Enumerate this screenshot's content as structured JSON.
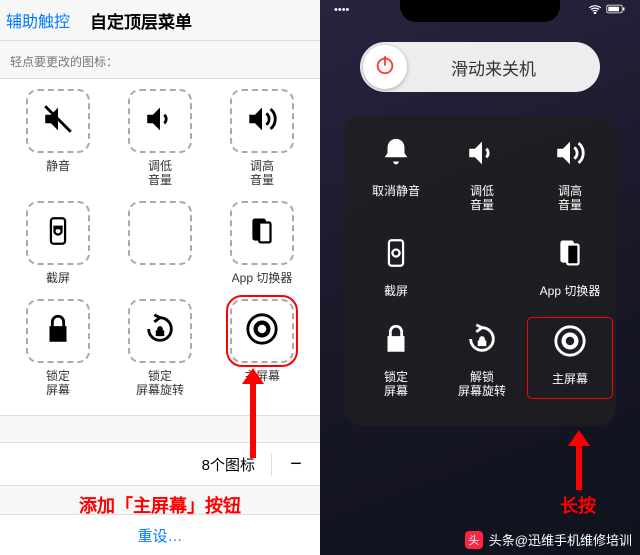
{
  "left": {
    "back": "辅助触控",
    "title": "自定顶层菜单",
    "hint": "轻点要更改的图标：",
    "items": [
      {
        "label": "静音"
      },
      {
        "label": "调低\n音量"
      },
      {
        "label": "调高\n音量"
      },
      {
        "label": "截屏"
      },
      {
        "label": ""
      },
      {
        "label": "App 切换器"
      },
      {
        "label": "锁定\n屏幕"
      },
      {
        "label": "锁定\n屏幕旋转"
      },
      {
        "label": "主屏幕"
      }
    ],
    "count_label": "8个图标",
    "caption": "添加「主屏幕」按钮",
    "reset": "重设…"
  },
  "right": {
    "power_label": "滑动来关机",
    "items": [
      {
        "label": "取消静音"
      },
      {
        "label": "调低\n音量"
      },
      {
        "label": "调高\n音量"
      },
      {
        "label": "截屏"
      },
      {
        "label": ""
      },
      {
        "label": "App 切换器"
      },
      {
        "label": "锁定\n屏幕"
      },
      {
        "label": "解锁\n屏幕旋转"
      },
      {
        "label": "主屏幕"
      }
    ],
    "caption": "长按"
  },
  "watermark": {
    "logo": "头",
    "text": "头条@迅维手机维修培训"
  },
  "colors": {
    "ios_blue": "#007aff",
    "annotation_red": "#ff0000",
    "power_red": "#ff3b30"
  }
}
